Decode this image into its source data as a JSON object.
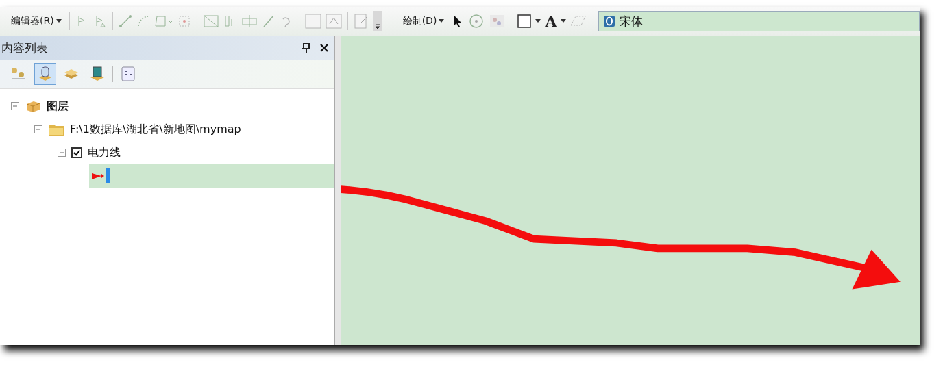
{
  "toolbar": {
    "editor_menu": "编辑器(R)",
    "draw_menu": "绘制(D)",
    "text_tool": "A",
    "font_field": "宋体"
  },
  "toc": {
    "title": "内容列表",
    "tabs": [
      {
        "selected": false
      },
      {
        "selected": true
      },
      {
        "selected": false
      },
      {
        "selected": false
      },
      {
        "selected": false
      }
    ]
  },
  "tree": [
    {
      "label": "图层",
      "kind": "frame",
      "expanded": true,
      "children": [
        {
          "label": "F:\\1数据库\\湖北省\\新地图\\mymap",
          "kind": "folder",
          "expanded": true,
          "children": [
            {
              "label": "电力线",
              "kind": "layer",
              "expanded": true,
              "checked": true,
              "children": [
                {
                  "kind": "symbol",
                  "selected": true
                }
              ]
            }
          ]
        }
      ]
    }
  ]
}
